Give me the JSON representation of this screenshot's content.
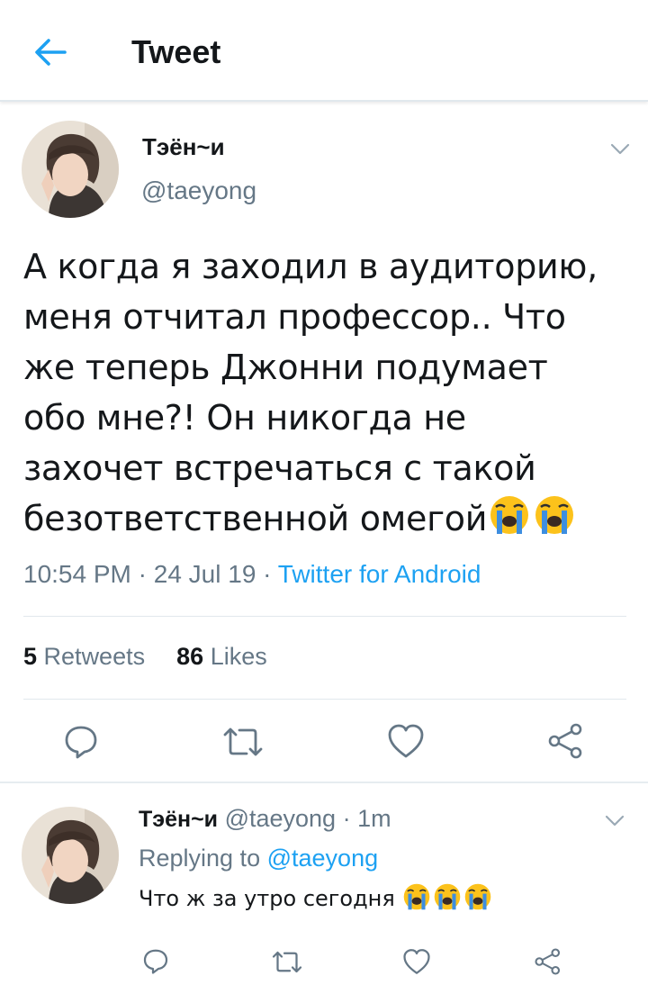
{
  "header": {
    "title": "Tweet",
    "back_icon": "arrow-left-icon"
  },
  "tweet": {
    "author_name": "Тэён~и",
    "author_handle": "@taeyong",
    "text_lines": [
      "А когда я заходил в аудиторию,",
      "меня отчитал профессор.. Что",
      "же теперь Джонни подумает",
      "обо мне?! Он никогда не",
      "захочет встречаться с такой",
      "безответственной омегой"
    ],
    "emoji": [
      "😭",
      "😭"
    ],
    "time": "10:54 PM",
    "date": "24 Jul 19",
    "source": "Twitter for Android",
    "retweets_count": "5",
    "retweets_label": "Retweets",
    "likes_count": "86",
    "likes_label": "Likes"
  },
  "reply": {
    "author_name": "Тэён~и",
    "author_handle": "@taeyong",
    "age": "1m",
    "replying_label": "Replying to",
    "replying_to": "@taeyong",
    "text": "Что ж за утро сегодня",
    "emoji": [
      "😭",
      "😭",
      "😭"
    ]
  },
  "colors": {
    "accent": "#1da1f2",
    "muted": "#657786",
    "text": "#14171a",
    "divider": "#e1e8ed"
  }
}
